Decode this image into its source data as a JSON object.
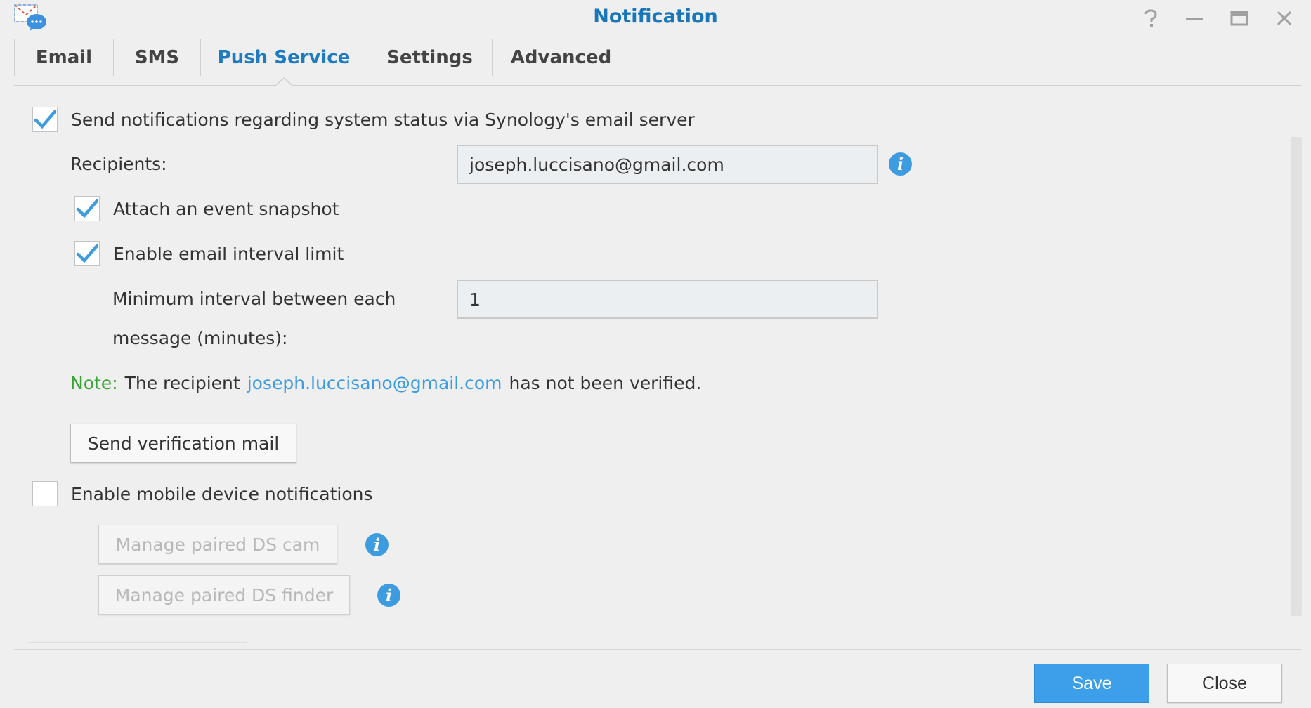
{
  "window": {
    "title": "Notification",
    "controls": [
      "help-icon",
      "minimize-icon",
      "maximize-icon",
      "close-icon"
    ]
  },
  "tabs": [
    {
      "label": "Email",
      "active": false
    },
    {
      "label": "SMS",
      "active": false
    },
    {
      "label": "Push Service",
      "active": true
    },
    {
      "label": "Settings",
      "active": false
    },
    {
      "label": "Advanced",
      "active": false
    }
  ],
  "email_push": {
    "checkbox_label": "Send notifications regarding system status via Synology's email server",
    "checked": true,
    "recipients_label": "Recipients:",
    "recipients_value": "joseph.luccisano@gmail.com",
    "attach_snapshot_label": "Attach an event snapshot",
    "attach_snapshot_checked": true,
    "interval_limit_label": "Enable email interval limit",
    "interval_limit_checked": true,
    "interval_label_line1": "Minimum interval between each",
    "interval_label_line2": "message (minutes):",
    "interval_value": "1",
    "note_label": "Note:",
    "note_prefix": "The recipient",
    "note_email": "joseph.luccisano@gmail.com",
    "note_suffix": "has not been verified.",
    "verify_button": "Send verification mail"
  },
  "mobile": {
    "checkbox_label": "Enable mobile device notifications",
    "checked": false,
    "manage_cam_button": "Manage paired DS cam",
    "manage_finder_button": "Manage paired DS finder"
  },
  "footer": {
    "save_label": "Save",
    "close_label": "Close"
  },
  "colors": {
    "accent": "#1976b9",
    "primary_button": "#3d9fe9",
    "info": "#3d9be0",
    "note": "#3aa335",
    "check": "#3d9be0"
  }
}
